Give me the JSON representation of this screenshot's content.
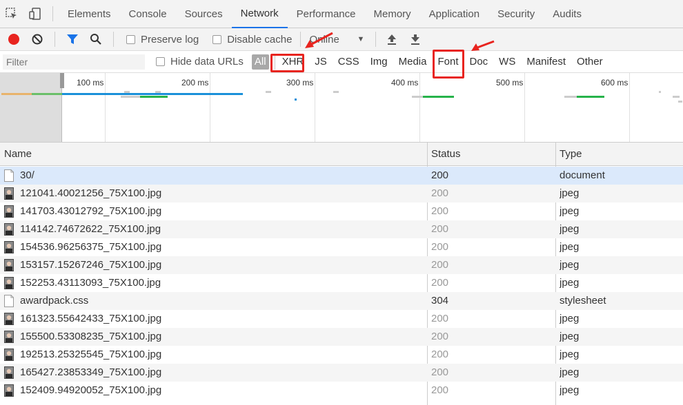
{
  "tabs": {
    "items": [
      "Elements",
      "Console",
      "Sources",
      "Network",
      "Performance",
      "Memory",
      "Application",
      "Security",
      "Audits"
    ]
  },
  "toolbar": {
    "preserve_log": "Preserve log",
    "disable_cache": "Disable cache",
    "throttle": "Online"
  },
  "filterbar": {
    "filter_placeholder": "Filter",
    "hide_data_urls": "Hide data URLs",
    "types": [
      "All",
      "XHR",
      "JS",
      "CSS",
      "Img",
      "Media",
      "Font",
      "Doc",
      "WS",
      "Manifest",
      "Other"
    ]
  },
  "overview": {
    "ticks": [
      "100 ms",
      "200 ms",
      "300 ms",
      "400 ms",
      "500 ms",
      "600 ms"
    ]
  },
  "table": {
    "headers": {
      "name": "Name",
      "status": "Status",
      "type": "Type"
    },
    "rows": [
      {
        "name": "30/",
        "status": "200",
        "type": "document",
        "icon": "document-file-icon"
      },
      {
        "name": "121041.40021256_75X100.jpg",
        "status": "200",
        "type": "jpeg",
        "icon": "image-thumbnail-icon"
      },
      {
        "name": "141703.43012792_75X100.jpg",
        "status": "200",
        "type": "jpeg",
        "icon": "image-thumbnail-icon"
      },
      {
        "name": "114142.74672622_75X100.jpg",
        "status": "200",
        "type": "jpeg",
        "icon": "image-thumbnail-icon"
      },
      {
        "name": "154536.96256375_75X100.jpg",
        "status": "200",
        "type": "jpeg",
        "icon": "image-thumbnail-icon"
      },
      {
        "name": "153157.15267246_75X100.jpg",
        "status": "200",
        "type": "jpeg",
        "icon": "image-thumbnail-icon"
      },
      {
        "name": "152253.43113093_75X100.jpg",
        "status": "200",
        "type": "jpeg",
        "icon": "image-thumbnail-icon"
      },
      {
        "name": "awardpack.css",
        "status": "304",
        "type": "stylesheet",
        "icon": "stylesheet-file-icon"
      },
      {
        "name": "161323.55642433_75X100.jpg",
        "status": "200",
        "type": "jpeg",
        "icon": "image-thumbnail-icon"
      },
      {
        "name": "155500.53308235_75X100.jpg",
        "status": "200",
        "type": "jpeg",
        "icon": "image-thumbnail-icon"
      },
      {
        "name": "192513.25325545_75X100.jpg",
        "status": "200",
        "type": "jpeg",
        "icon": "image-thumbnail-icon"
      },
      {
        "name": "165427.23853349_75X100.jpg",
        "status": "200",
        "type": "jpeg",
        "icon": "image-thumbnail-icon"
      },
      {
        "name": "152409.94920052_75X100.jpg",
        "status": "200",
        "type": "jpeg",
        "icon": "image-thumbnail-icon"
      }
    ]
  },
  "colors": {
    "record": "#e8241f",
    "accent": "#1a73e8",
    "annotation": "#e8241f",
    "selected_row": "#dbe9fb"
  }
}
